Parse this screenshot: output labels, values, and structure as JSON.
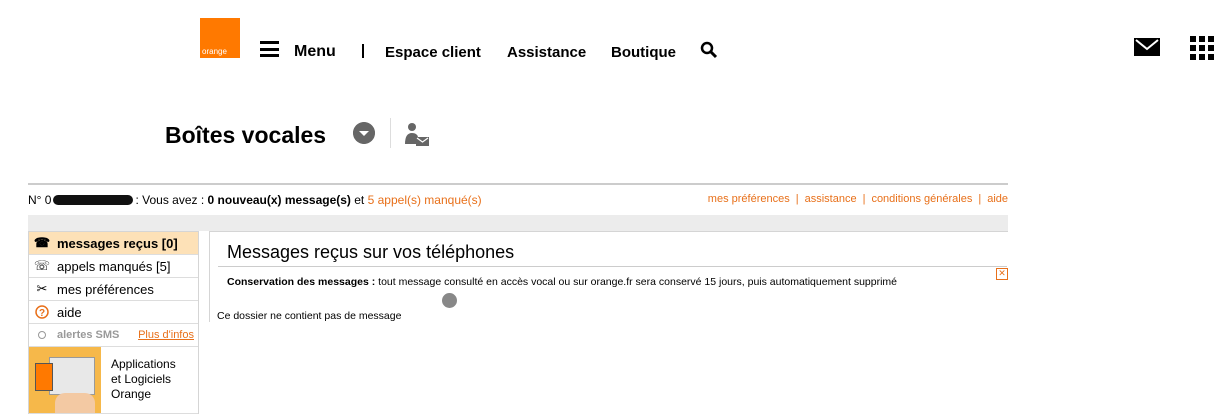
{
  "header": {
    "logo_text": "orange",
    "menu_label": "Menu",
    "nav": [
      "Espace client",
      "Assistance",
      "Boutique"
    ],
    "icons": [
      "hamburger-icon",
      "search-icon",
      "mail-icon",
      "apps-grid-icon"
    ]
  },
  "page": {
    "title": "Boîtes vocales"
  },
  "status": {
    "prefix": "N° 0",
    "text1": ": Vous avez : ",
    "new_messages": "0 nouveau(x) message(s)",
    "and": " et ",
    "missed": "5 appel(s) manqué(s)"
  },
  "top_links": [
    "mes préférences",
    "assistance",
    "conditions générales",
    "aide"
  ],
  "sidebar": {
    "items": [
      {
        "label": "messages reçus [0]",
        "icon": "voicemail-icon"
      },
      {
        "label": "appels manqués [5]",
        "icon": "missed-call-icon"
      },
      {
        "label": "mes préférences",
        "icon": "tools-icon"
      },
      {
        "label": "aide",
        "icon": "help-icon"
      }
    ],
    "sms": {
      "label": "alertes SMS",
      "link": "Plus d'infos"
    },
    "promo": {
      "line1": "Applications",
      "line2": "et Logiciels",
      "line3": "Orange"
    }
  },
  "content": {
    "title": "Messages reçus sur vos téléphones",
    "conservation_label": "Conservation des messages :",
    "conservation_text": " tout message consulté en accès vocal ou sur orange.fr sera conservé 15 jours, puis automatiquement supprimé",
    "empty": "Ce dossier ne contient pas de message"
  },
  "colors": {
    "brand": "#ff7900",
    "link": "#e8701a",
    "active_bg": "#fde1b7"
  }
}
